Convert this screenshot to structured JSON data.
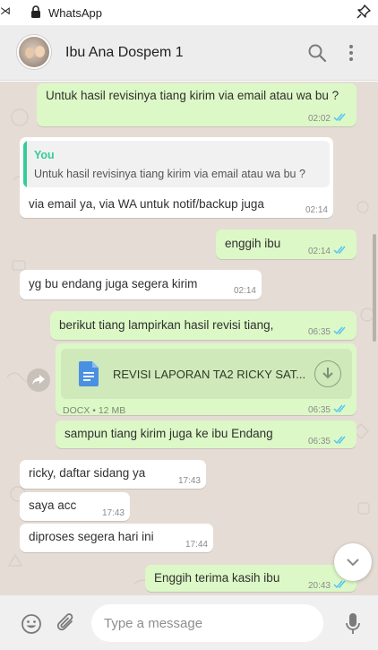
{
  "window": {
    "title": "WhatsApp",
    "left_glyph": "⋊"
  },
  "header": {
    "contact_name": "Ibu Ana Dospem 1"
  },
  "messages": [
    {
      "text": "Untuk hasil revisinya tiang kirim via email atau wa bu ?",
      "time": "02:02",
      "direction": "out",
      "status": "read"
    },
    {
      "quote_author": "You",
      "quote_text": "Untuk hasil revisinya tiang kirim via email atau wa bu ?",
      "text": "via email ya, via WA untuk notif/backup juga",
      "time": "02:14",
      "direction": "in"
    },
    {
      "text": "enggih ibu",
      "time": "02:14",
      "direction": "out",
      "status": "read"
    },
    {
      "text": "yg bu endang juga segera kirim",
      "time": "02:14",
      "direction": "in"
    },
    {
      "text": "berikut tiang lampirkan hasil revisi tiang,",
      "time": "06:35",
      "direction": "out",
      "status": "read"
    },
    {
      "document_name": "REVISI LAPORAN TA2 RICKY SAT...",
      "document_info": "DOCX • 12 MB",
      "time": "06:35",
      "direction": "out",
      "status": "read"
    },
    {
      "text": "sampun tiang kirim juga ke ibu Endang",
      "time": "06:35",
      "direction": "out",
      "status": "read"
    },
    {
      "text": "ricky, daftar sidang ya",
      "time": "17:43",
      "direction": "in"
    },
    {
      "text": "saya acc",
      "time": "17:43",
      "direction": "in"
    },
    {
      "text": "diproses segera hari ini",
      "time": "17:44",
      "direction": "in"
    },
    {
      "text": "Enggih terima kasih ibu",
      "time": "20:43",
      "direction": "out",
      "status": "read"
    }
  ],
  "composer": {
    "placeholder": "Type a message"
  },
  "icons": {
    "lock": "lock-icon",
    "pin": "pin-icon",
    "search": "search-icon",
    "menu": "menu-icon",
    "forward": "forward-icon",
    "download": "download-icon",
    "document": "document-icon",
    "emoji": "emoji-icon",
    "attach": "paperclip-icon",
    "mic": "microphone-icon",
    "scroll_down": "chevron-down-icon"
  },
  "colors": {
    "outgoing_bubble": "#dcf8c6",
    "incoming_bubble": "#ffffff",
    "chat_background": "#e5ddd5",
    "read_ticks": "#4fc3f7",
    "quote_accent": "#35cd96",
    "header_bg": "#ededed",
    "document_icon": "#4a90e2"
  }
}
